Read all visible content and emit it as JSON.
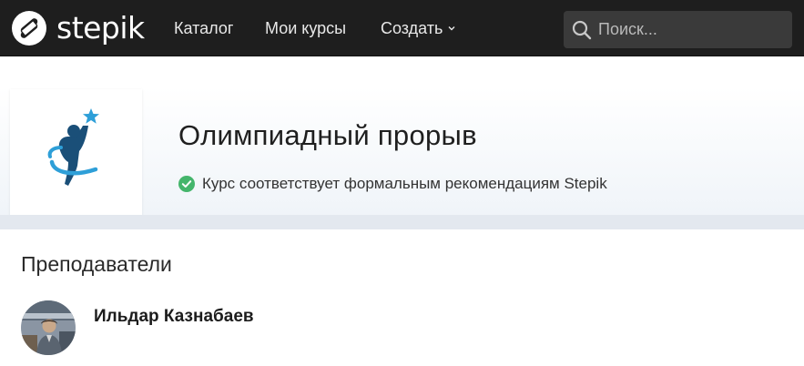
{
  "navbar": {
    "logo_text": "stepik",
    "logo_icon": "stepik-logo-icon",
    "items": [
      {
        "label": "Каталог"
      },
      {
        "label": "Мои курсы"
      },
      {
        "label": "Создать"
      }
    ],
    "create_icon": "chevron-down-icon",
    "search": {
      "placeholder": "Поиск...",
      "value": "",
      "icon": "search-icon"
    },
    "colors": {
      "background": "#1e1e1e",
      "search_bg": "#3a3a3a"
    }
  },
  "course": {
    "title": "Олимпиадный прорыв",
    "cover_icon": "athlete-star-icon",
    "compliance_icon": "check-circle-icon",
    "compliance_text": "Курс соответствует формальным рекомендациям Stepik",
    "colors": {
      "check": "#44b56b",
      "figure": "#1a4f78",
      "accent": "#2e9fd8"
    }
  },
  "instructors": {
    "title": "Преподаватели",
    "items": [
      {
        "name": "Ильдар Казнабаев",
        "avatar": "user-avatar"
      }
    ]
  }
}
